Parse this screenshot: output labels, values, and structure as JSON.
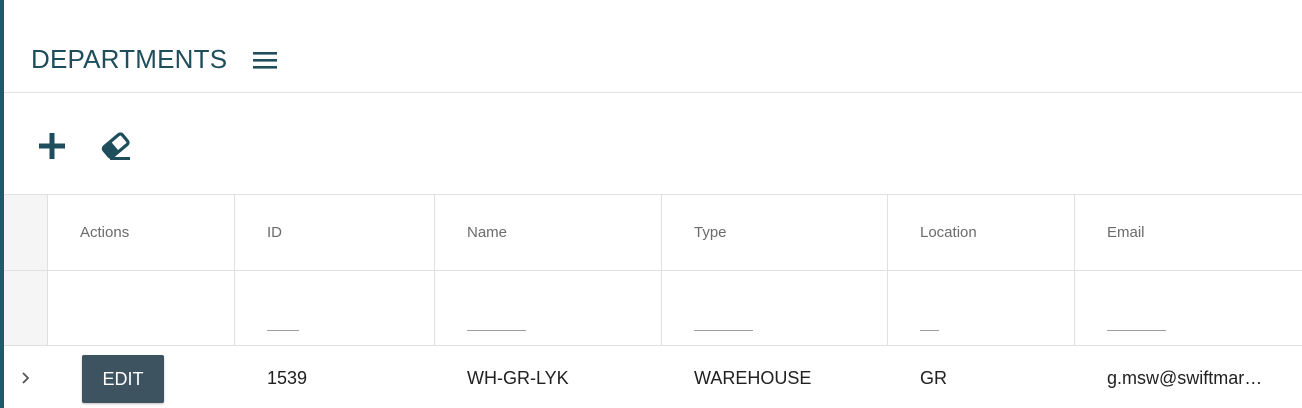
{
  "colors": {
    "accent": "#1e4d5c",
    "edit_button": "#3d5360",
    "gutter": "#f5f5f5"
  },
  "header": {
    "title": "DEPARTMENTS",
    "menu_icon": "hamburger-menu-icon"
  },
  "toolbar": {
    "add_icon": "plus-icon",
    "clear_icon": "eraser-icon"
  },
  "table": {
    "columns": [
      "Actions",
      "ID",
      "Name",
      "Type",
      "Location",
      "Email"
    ],
    "rows": [
      {
        "action_label": "EDIT",
        "id": "1539",
        "name": "WH-GR-LYK",
        "type": "WAREHOUSE",
        "location": "GR",
        "email": "g.msw@swiftmar…"
      }
    ]
  }
}
